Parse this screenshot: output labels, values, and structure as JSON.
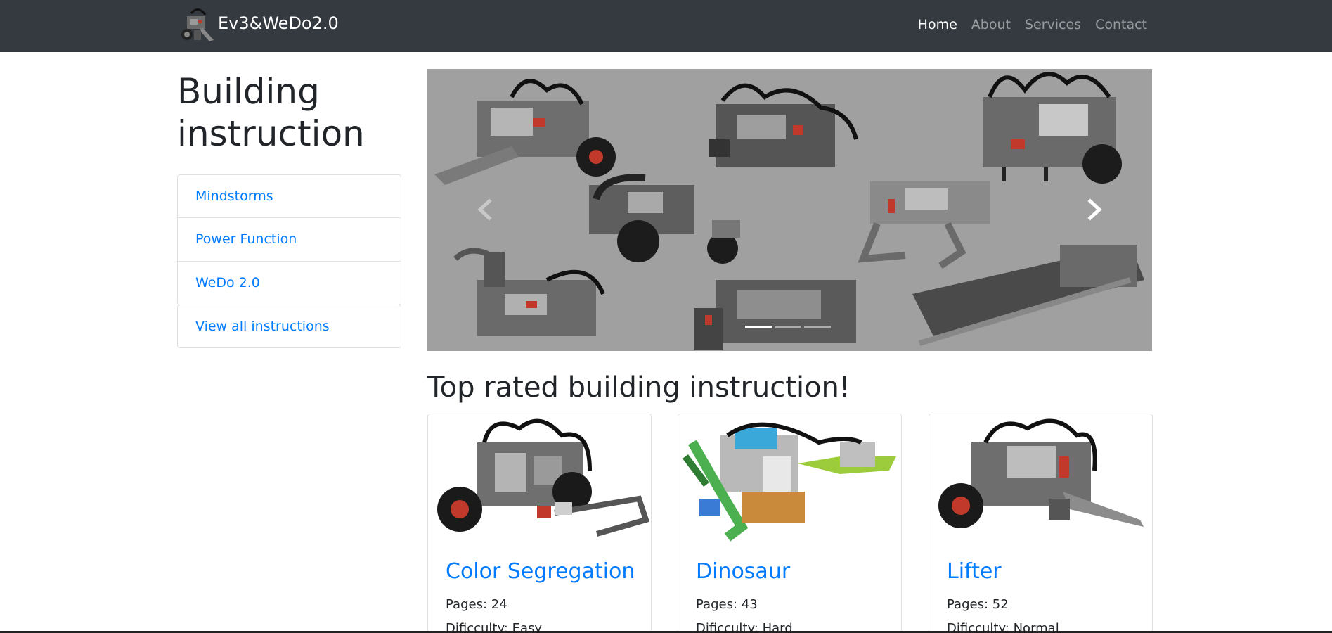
{
  "navbar": {
    "brand": "Ev3&WeDo2.0",
    "logo_icon": "robot-logo-icon",
    "links": [
      {
        "label": "Home",
        "active": true
      },
      {
        "label": "About",
        "active": false
      },
      {
        "label": "Services",
        "active": false
      },
      {
        "label": "Contact",
        "active": false
      }
    ]
  },
  "sidebar": {
    "title": "Building instruction",
    "items": [
      {
        "label": "Mindstorms"
      },
      {
        "label": "Power Function"
      },
      {
        "label": "WeDo 2.0"
      }
    ],
    "view_all": "View all instructions"
  },
  "carousel": {
    "prev_icon": "chevron-left-icon",
    "next_icon": "chevron-right-icon",
    "slides": 3,
    "active_slide": 1
  },
  "top_rated": {
    "heading": "Top rated building instruction!",
    "cards": [
      {
        "title": "Color Segregation",
        "pages": "Pages: 24",
        "difficulty": "Dificculty: Easy"
      },
      {
        "title": "Dinosaur",
        "pages": "Pages: 43",
        "difficulty": "Dificculty: Hard"
      },
      {
        "title": "Lifter",
        "pages": "Pages: 52",
        "difficulty": "Dificculty: Normal"
      }
    ]
  },
  "colors": {
    "navbar_bg": "#343a40",
    "link": "#007bff",
    "carousel_bg": "#a0a0a0"
  }
}
